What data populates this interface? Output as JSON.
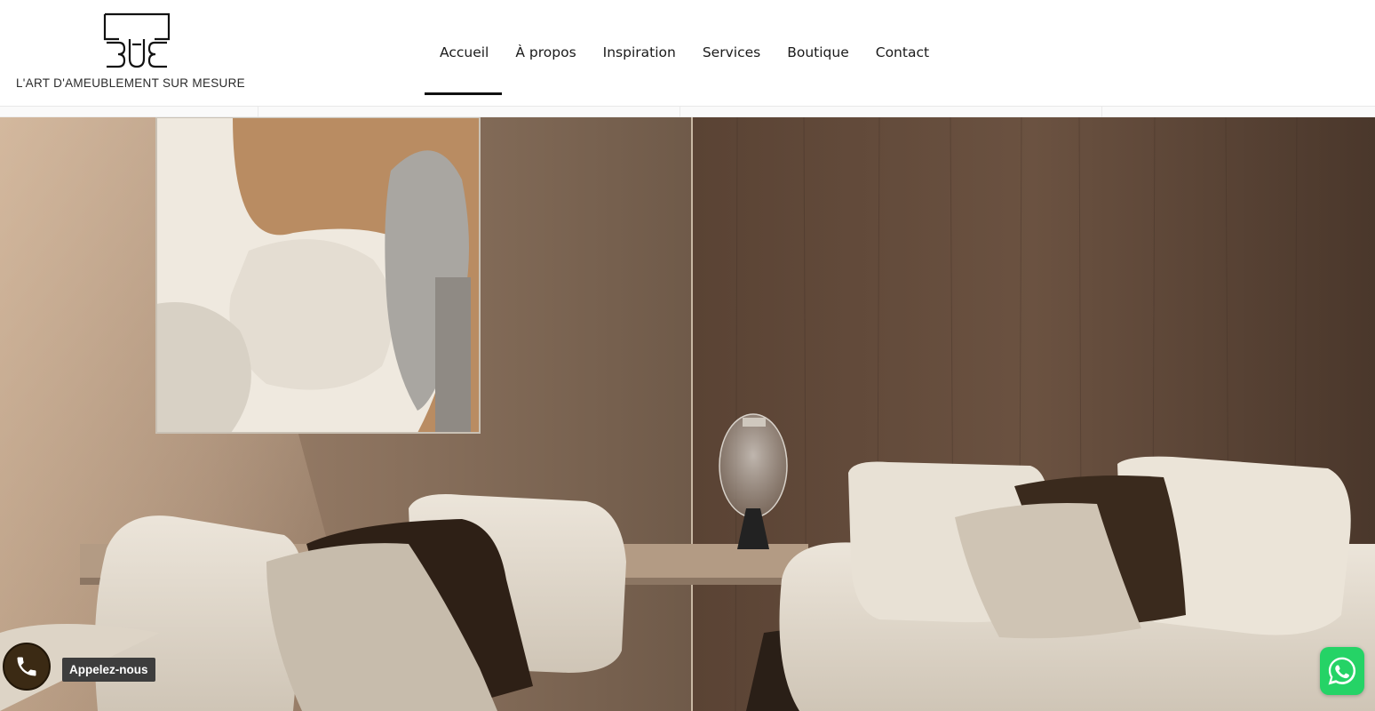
{
  "brand": {
    "logo_icon": "bte-monogram",
    "tagline": "L'ART D'AMEUBLEMENT SUR MESURE"
  },
  "nav": {
    "items": [
      {
        "label": "Accueil",
        "active": true
      },
      {
        "label": "À propos",
        "active": false
      },
      {
        "label": "Inspiration",
        "active": false
      },
      {
        "label": "Services",
        "active": false
      },
      {
        "label": "Boutique",
        "active": false
      },
      {
        "label": "Contact",
        "active": false
      }
    ]
  },
  "hero": {
    "scene": "living-room-photo"
  },
  "widgets": {
    "call": {
      "icon": "phone-icon",
      "label": "Appelez-nous",
      "color": "#3b2a14"
    },
    "whatsapp": {
      "icon": "whatsapp-icon",
      "color": "#25d366"
    }
  }
}
